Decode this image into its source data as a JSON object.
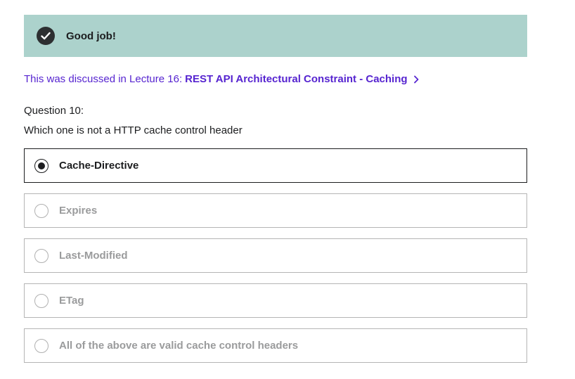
{
  "banner": {
    "icon": "check-circle-icon",
    "text": "Good job!",
    "background": "#acd2cc"
  },
  "lecture": {
    "prefix": "This was discussed in Lecture 16:",
    "link": "REST API Architectural Constraint - Caching",
    "icon": "chevron-right-icon",
    "color": "#5624d0"
  },
  "question": {
    "number": "Question 10:",
    "text": "Which one is not a HTTP cache control header"
  },
  "options": [
    {
      "label": "Cache-Directive",
      "selected": true
    },
    {
      "label": "Expires",
      "selected": false
    },
    {
      "label": "Last-Modified",
      "selected": false
    },
    {
      "label": "ETag",
      "selected": false
    },
    {
      "label": "All of the above are valid cache control headers",
      "selected": false
    }
  ]
}
